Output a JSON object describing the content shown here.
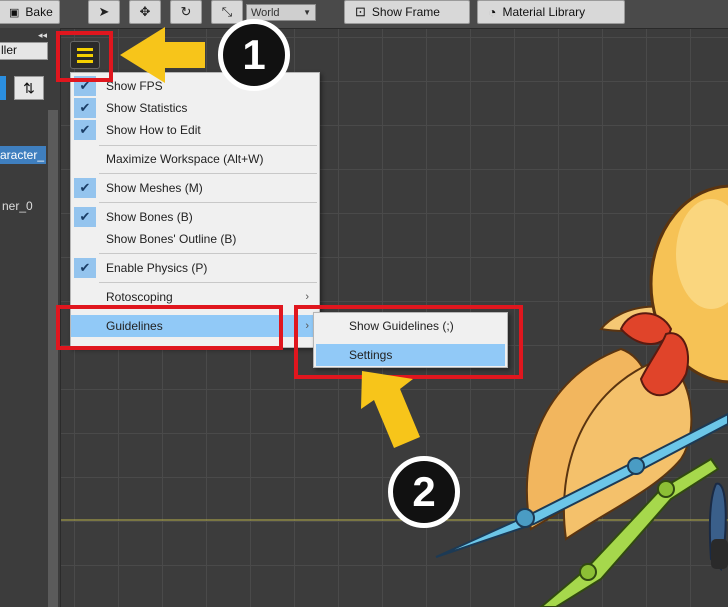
{
  "toolbar": {
    "bake_label": "Bake",
    "world_select_value": "World",
    "show_frame_label": "Show Frame",
    "material_library_label": "Material Library"
  },
  "left_panel": {
    "field_text": "ller",
    "item_1": "aracter_",
    "item_2": "ner_0",
    "collapse_glyph": "◂◂"
  },
  "menu": {
    "items": [
      {
        "label": "Show FPS",
        "checked": true
      },
      {
        "label": "Show Statistics",
        "checked": true
      },
      {
        "label": "Show How to Edit",
        "checked": true
      },
      {
        "label": "Maximize Workspace (Alt+W)",
        "checked": false
      },
      {
        "label": "Show Meshes (M)",
        "checked": true
      },
      {
        "label": "Show Bones (B)",
        "checked": true
      },
      {
        "label": "Show Bones' Outline (B)",
        "checked": false
      },
      {
        "label": "Enable Physics (P)",
        "checked": true
      },
      {
        "label": "Rotoscoping",
        "checked": false,
        "submenu": true
      },
      {
        "label": "Guidelines",
        "checked": false,
        "submenu": true,
        "highlighted": true
      }
    ]
  },
  "submenu": {
    "items": [
      {
        "label": "Show Guidelines (;)"
      },
      {
        "label": "Settings",
        "highlighted": true
      }
    ]
  },
  "callouts": {
    "step_1": "1",
    "step_2": "2"
  },
  "colors": {
    "highlight_red": "#e0161e",
    "arrow_yellow": "#f7c51a",
    "menu_selection": "#91c9f7",
    "check_bg": "#94c4ee"
  }
}
